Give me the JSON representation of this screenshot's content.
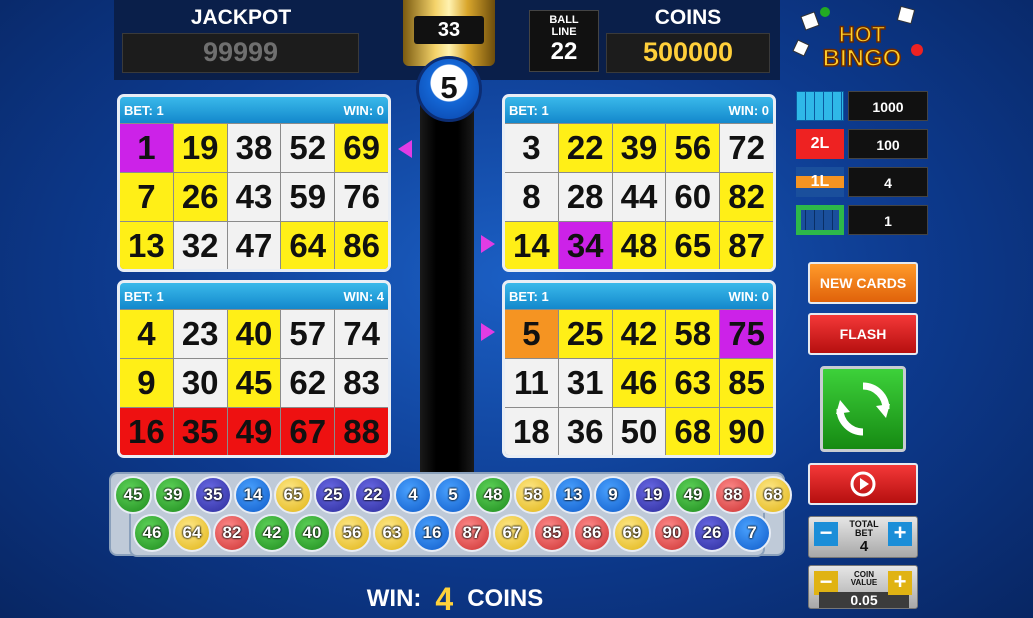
{
  "jackpot": {
    "label": "JACKPOT",
    "value": "99999"
  },
  "draw_counter": "33",
  "ball_line": {
    "label_line1": "BALL",
    "label_line2": "LINE",
    "value": "22"
  },
  "coins": {
    "label": "COINS",
    "value": "500000"
  },
  "current_ball": "5",
  "logo_text": "HOT BINGO",
  "cards": [
    {
      "bet": "BET: 1",
      "win": "WIN: 0",
      "cells": [
        [
          "1",
          "p"
        ],
        [
          "19",
          "y"
        ],
        [
          "38",
          ""
        ],
        [
          "52",
          ""
        ],
        [
          "69",
          "y"
        ],
        [
          "7",
          "y"
        ],
        [
          "26",
          "y"
        ],
        [
          "43",
          ""
        ],
        [
          "59",
          ""
        ],
        [
          "76",
          ""
        ],
        [
          "13",
          "y"
        ],
        [
          "32",
          ""
        ],
        [
          "47",
          ""
        ],
        [
          "64",
          "y"
        ],
        [
          "86",
          "y"
        ]
      ]
    },
    {
      "bet": "BET: 1",
      "win": "WIN: 0",
      "cells": [
        [
          "3",
          ""
        ],
        [
          "22",
          "y"
        ],
        [
          "39",
          "y"
        ],
        [
          "56",
          "y"
        ],
        [
          "72",
          ""
        ],
        [
          "8",
          ""
        ],
        [
          "28",
          ""
        ],
        [
          "44",
          ""
        ],
        [
          "60",
          ""
        ],
        [
          "82",
          "y"
        ],
        [
          "14",
          "y"
        ],
        [
          "34",
          "p"
        ],
        [
          "48",
          "y"
        ],
        [
          "65",
          "y"
        ],
        [
          "87",
          "y"
        ]
      ]
    },
    {
      "bet": "BET: 1",
      "win": "WIN: 4",
      "cells": [
        [
          "4",
          "y"
        ],
        [
          "23",
          ""
        ],
        [
          "40",
          "y"
        ],
        [
          "57",
          ""
        ],
        [
          "74",
          ""
        ],
        [
          "9",
          "y"
        ],
        [
          "30",
          ""
        ],
        [
          "45",
          "y"
        ],
        [
          "62",
          ""
        ],
        [
          "83",
          ""
        ],
        [
          "16",
          "r"
        ],
        [
          "35",
          "r"
        ],
        [
          "49",
          "r"
        ],
        [
          "67",
          "r"
        ],
        [
          "88",
          "r"
        ]
      ]
    },
    {
      "bet": "BET: 1",
      "win": "WIN: 0",
      "cells": [
        [
          "5",
          "o"
        ],
        [
          "25",
          "y"
        ],
        [
          "42",
          "y"
        ],
        [
          "58",
          "y"
        ],
        [
          "75",
          "p"
        ],
        [
          "11",
          ""
        ],
        [
          "31",
          ""
        ],
        [
          "46",
          "y"
        ],
        [
          "63",
          "y"
        ],
        [
          "85",
          "y"
        ],
        [
          "18",
          ""
        ],
        [
          "36",
          ""
        ],
        [
          "50",
          ""
        ],
        [
          "68",
          "y"
        ],
        [
          "90",
          "y"
        ]
      ]
    }
  ],
  "drawn_balls_row1": [
    [
      "45",
      "g"
    ],
    [
      "39",
      "g"
    ],
    [
      "35",
      "n"
    ],
    [
      "14",
      "b"
    ],
    [
      "65",
      "y"
    ],
    [
      "25",
      "n"
    ],
    [
      "22",
      "n"
    ],
    [
      "4",
      "b"
    ],
    [
      "5",
      "b"
    ],
    [
      "48",
      "g"
    ],
    [
      "58",
      "y"
    ],
    [
      "13",
      "b"
    ],
    [
      "9",
      "b"
    ],
    [
      "19",
      "n"
    ],
    [
      "49",
      "g"
    ],
    [
      "88",
      "r"
    ],
    [
      "68",
      "y"
    ]
  ],
  "drawn_balls_row2": [
    [
      "46",
      "g"
    ],
    [
      "64",
      "y"
    ],
    [
      "82",
      "r"
    ],
    [
      "42",
      "g"
    ],
    [
      "40",
      "g"
    ],
    [
      "56",
      "y"
    ],
    [
      "63",
      "y"
    ],
    [
      "16",
      "b"
    ],
    [
      "87",
      "r"
    ],
    [
      "67",
      "y"
    ],
    [
      "85",
      "r"
    ],
    [
      "86",
      "r"
    ],
    [
      "69",
      "y"
    ],
    [
      "90",
      "r"
    ],
    [
      "26",
      "n"
    ],
    [
      "7",
      "b"
    ]
  ],
  "win": {
    "label": "WIN:",
    "value": "4",
    "unit": "COINS"
  },
  "paytable": [
    {
      "icon": "full-card-pattern-icon",
      "value": "1000"
    },
    {
      "icon": "two-lines-pattern-icon",
      "value": "100",
      "badge": "2L"
    },
    {
      "icon": "one-line-pattern-icon",
      "value": "4",
      "badge": "1L"
    },
    {
      "icon": "corners-pattern-icon",
      "value": "1"
    }
  ],
  "buttons": {
    "new_cards": "NEW CARDS",
    "flash": "FLASH"
  },
  "total_bet": {
    "label_line1": "TOTAL",
    "label_line2": "BET",
    "value": "4",
    "minus": "−",
    "plus": "+"
  },
  "coin_value": {
    "label_line1": "COIN",
    "label_line2": "VALUE",
    "value": "0.05",
    "minus": "−",
    "plus": "+"
  },
  "colors": {
    "yellow": "#ffef17",
    "purple": "#cc22e8",
    "orange": "#f59422",
    "red": "#ee1111",
    "accent_blue": "#1388cc"
  }
}
